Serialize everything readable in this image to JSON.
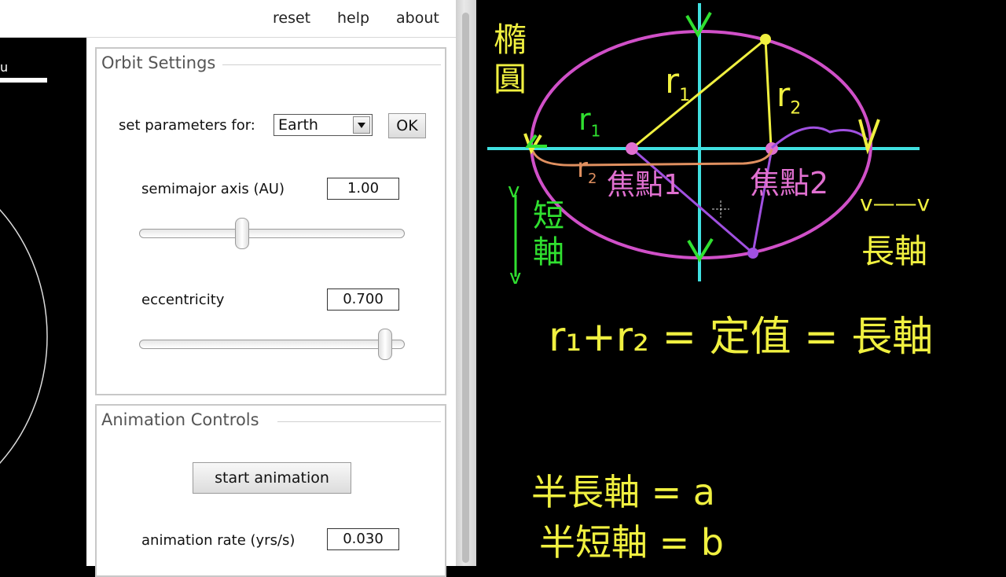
{
  "menu": {
    "reset": "reset",
    "help": "help",
    "about": "about"
  },
  "canvas": {
    "scale_label": "u"
  },
  "orbit_settings": {
    "title": "Orbit Settings",
    "set_params_label": "set parameters for:",
    "planet_selected": "Earth",
    "ok_label": "OK",
    "semimajor_label": "semimajor axis (AU)",
    "semimajor_value": "1.00",
    "semimajor_slider_fraction": 0.38,
    "eccentricity_label": "eccentricity",
    "eccentricity_value": "0.700",
    "eccentricity_slider_fraction": 0.95
  },
  "animation": {
    "title": "Animation Controls",
    "start_label": "start animation",
    "rate_label": "animation rate (yrs/s)",
    "rate_value": "0.030"
  },
  "board": {
    "ellipse_label": "橢圓",
    "r1": "r",
    "r1_sub": "1",
    "r2": "r",
    "r2_sub": "2",
    "focus1": "焦點1",
    "focus2": "焦點2",
    "minor_axis": "短軸",
    "major_axis": "長軸",
    "v_mark": "v",
    "major_mark": "v——v",
    "equation": "r₁+r₂ = 定值 = 長軸",
    "semi_major": "半長軸 = a",
    "semi_minor": "半短軸 = b"
  },
  "colors": {
    "ellipse": "#d050c8",
    "axes": "#40e0e0",
    "yellow": "#f0f040",
    "purple": "#a050e0",
    "green": "#30e030",
    "orange": "#e09060"
  }
}
